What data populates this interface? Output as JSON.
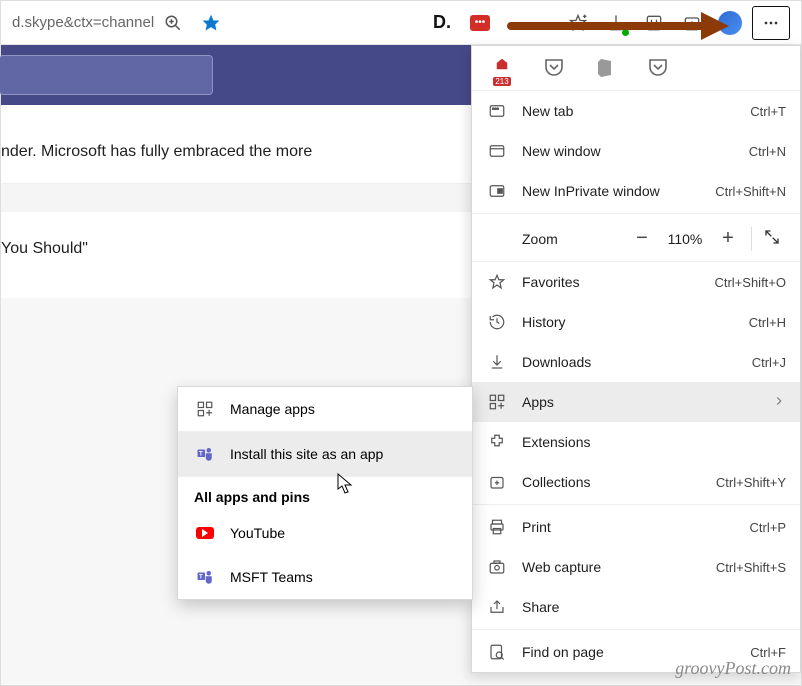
{
  "toolbar": {
    "url_fragment": "d.skype&ctx=channel"
  },
  "article": {
    "line1": "nder. Microsoft has fully embraced the more",
    "line2": "You Should\""
  },
  "menu": {
    "calendar_badge": "213",
    "new_tab": {
      "label": "New tab",
      "shortcut": "Ctrl+T"
    },
    "new_window": {
      "label": "New window",
      "shortcut": "Ctrl+N"
    },
    "new_inprivate": {
      "label": "New InPrivate window",
      "shortcut": "Ctrl+Shift+N"
    },
    "zoom": {
      "label": "Zoom",
      "value": "110%"
    },
    "favorites": {
      "label": "Favorites",
      "shortcut": "Ctrl+Shift+O"
    },
    "history": {
      "label": "History",
      "shortcut": "Ctrl+H"
    },
    "downloads": {
      "label": "Downloads",
      "shortcut": "Ctrl+J"
    },
    "apps": {
      "label": "Apps"
    },
    "extensions": {
      "label": "Extensions"
    },
    "collections": {
      "label": "Collections",
      "shortcut": "Ctrl+Shift+Y"
    },
    "print": {
      "label": "Print",
      "shortcut": "Ctrl+P"
    },
    "web_capture": {
      "label": "Web capture",
      "shortcut": "Ctrl+Shift+S"
    },
    "share": {
      "label": "Share"
    },
    "find": {
      "label": "Find on page",
      "shortcut": "Ctrl+F"
    }
  },
  "submenu": {
    "manage": "Manage apps",
    "install": "Install this site as an app",
    "heading": "All apps and pins",
    "youtube": "YouTube",
    "msft_teams": "MSFT Teams"
  },
  "watermark": "groovyPost.com"
}
